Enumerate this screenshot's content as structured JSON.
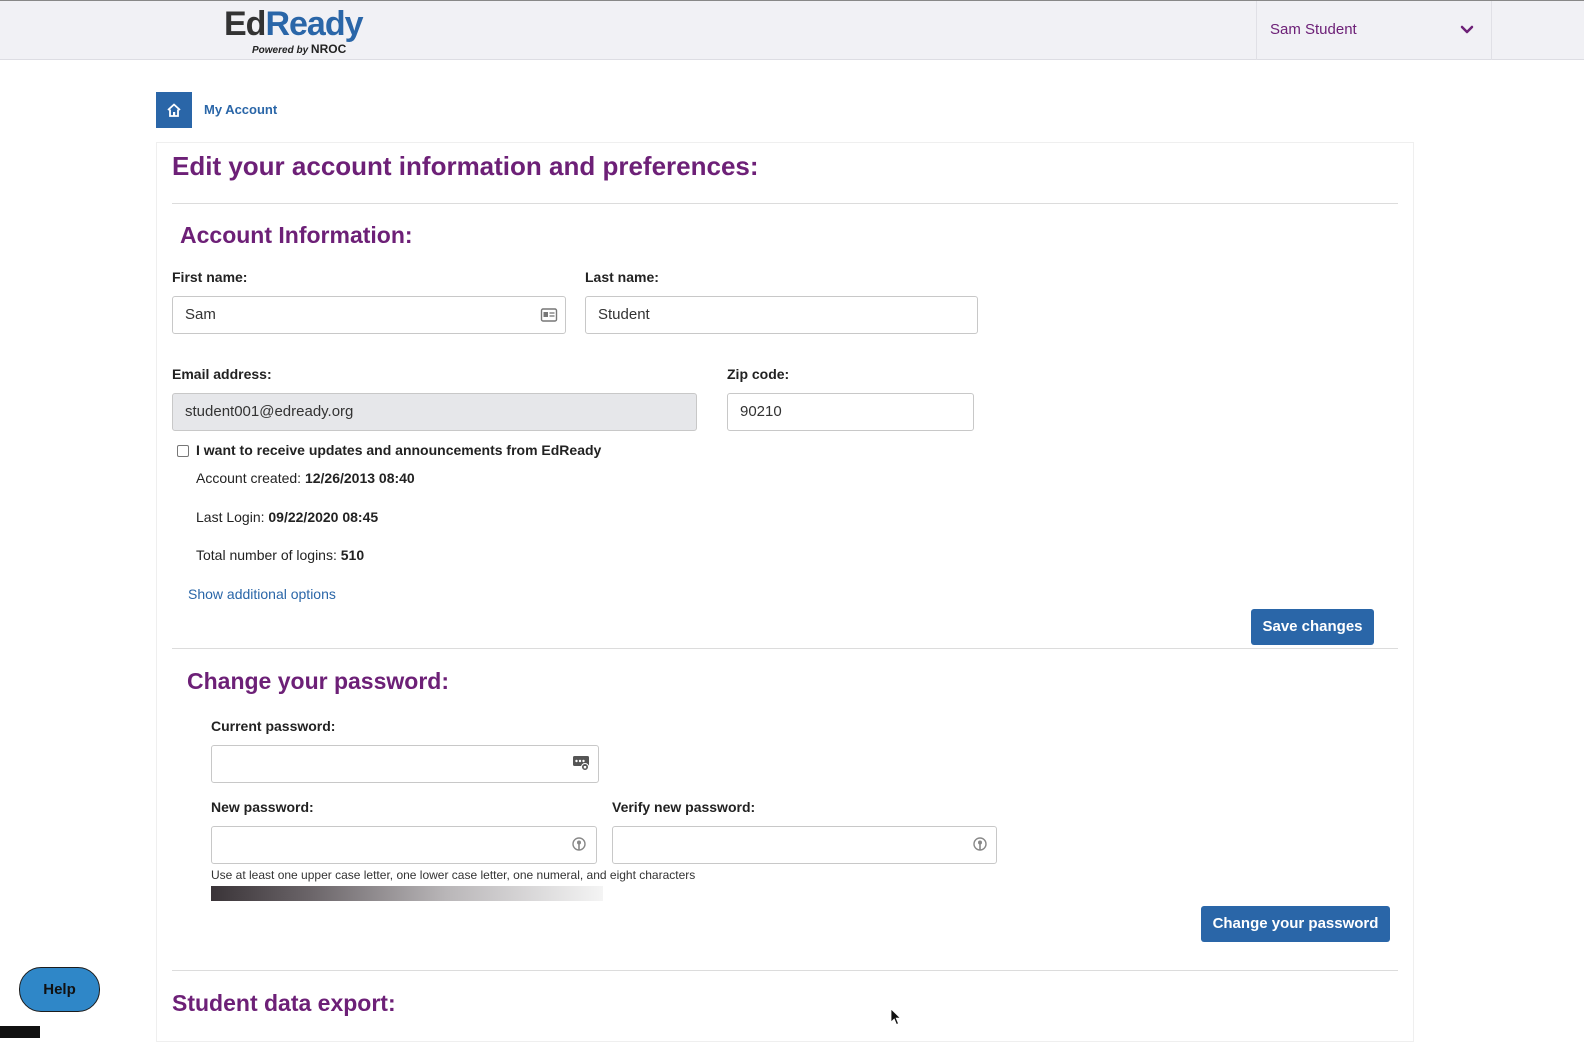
{
  "header": {
    "logo_ed": "Ed",
    "logo_ready": "Ready",
    "logo_powered": "Powered by",
    "logo_nroc": "NROC",
    "user_name": "Sam Student"
  },
  "breadcrumb": {
    "current": "My Account"
  },
  "page": {
    "title": "Edit your account information and preferences:"
  },
  "account_info": {
    "section_title": "Account Information:",
    "first_name_label": "First name:",
    "first_name_value": "Sam",
    "last_name_label": "Last name:",
    "last_name_value": "Student",
    "email_label": "Email address:",
    "email_value": "student001@edready.org",
    "zip_label": "Zip code:",
    "zip_value": "90210",
    "updates_checkbox_label": "I want to receive updates and announcements from EdReady",
    "updates_checked": false,
    "created_label": "Account created: ",
    "created_value": "12/26/2013 08:40",
    "last_login_label": "Last Login: ",
    "last_login_value": "09/22/2020 08:45",
    "total_logins_label": "Total number of logins: ",
    "total_logins_value": "510",
    "show_options_link": "Show additional options",
    "save_button": "Save changes"
  },
  "password": {
    "section_title": "Change your password:",
    "current_label": "Current password:",
    "current_value": "",
    "new_label": "New password:",
    "new_value": "",
    "verify_label": "Verify new password:",
    "verify_value": "",
    "hint": "Use at least one upper case letter, one lower case letter, one numeral, and eight characters",
    "change_button": "Change your password"
  },
  "export": {
    "section_title": "Student data export:"
  },
  "help": {
    "label": "Help"
  },
  "colors": {
    "brand_blue": "#2a66a8",
    "brand_purple": "#6d2077"
  }
}
